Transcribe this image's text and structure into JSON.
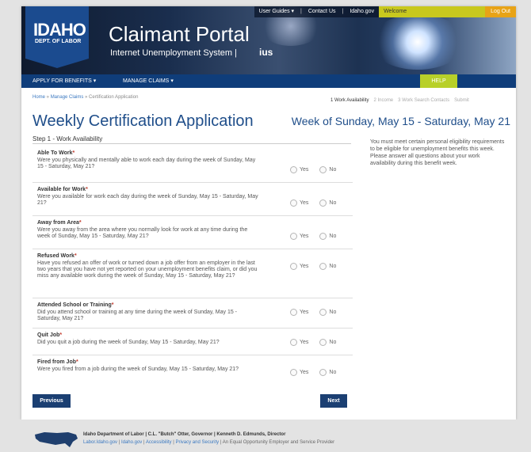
{
  "topbar": {
    "user_guides": "User Guides",
    "contact_us": "Contact Us",
    "idaho_gov": "Idaho.gov",
    "welcome": "Welcome",
    "logout": "Log Out"
  },
  "logo": {
    "line1": "IDAHO",
    "line2": "DEPT. OF LABOR"
  },
  "header": {
    "title": "Claimant Portal",
    "subtitle": "Internet Unemployment System |",
    "mark": "ius"
  },
  "nav": {
    "apply": "APPLY FOR BENEFITS",
    "manage": "MANAGE CLAIMS",
    "help": "HELP"
  },
  "breadcrumb": {
    "home": "Home",
    "manage": "Manage Claims",
    "current": "Certification Application"
  },
  "steps": [
    "1  Work Availability",
    "2  Income",
    "3  Work Search Contacts",
    "Submit"
  ],
  "page": {
    "title": "Weekly Certification Application",
    "week": "Week of Sunday, May 15 - Saturday, May 21",
    "step_title": "Step 1 - Work Availability"
  },
  "sidebar": {
    "text": "You must meet certain personal eligibility requirements to be eligible for unemployment benefits this week. Please answer all questions about your work availability during this benefit week."
  },
  "option_yes": "Yes",
  "option_no": "No",
  "questions": [
    {
      "title": "Able To Work",
      "body": "Were you physically and mentally able to work each day during the week of Sunday, May 15 - Saturday, May 21?"
    },
    {
      "title": "Available for Work",
      "body": "Were you available for work each day during the week of Sunday, May 15 - Saturday, May 21?"
    },
    {
      "title": "Away from Area",
      "body": "Were you away from the area where you normally look for work at any time during the week of Sunday, May 15 - Saturday, May 21?"
    },
    {
      "title": "Refused Work",
      "body": "Have you refused an offer of work or turned down a job offer from an employer in the last two years that you have not yet reported on your unemployment benefits claim, or did you miss any available work during the week of Sunday, May 15 - Saturday, May 21?"
    },
    {
      "title": "Attended School or Training",
      "body": "Did you attend school or training at any time during the week of Sunday, May 15 - Saturday, May 21?"
    },
    {
      "title": "Quit Job",
      "body": "Did you quit a job during the week of Sunday, May 15 - Saturday, May 21?"
    },
    {
      "title": "Fired from Job",
      "body": "Were you fired from a job during the week of Sunday, May 15 - Saturday, May 21?"
    }
  ],
  "buttons": {
    "previous": "Previous",
    "next": "Next"
  },
  "footer": {
    "line1": "Idaho Department of Labor  |  C.L. \"Butch\" Otter, Governor  |  Kenneth D. Edmunds, Director",
    "links": [
      "Labor.Idaho.gov",
      "Idaho.gov",
      "Accessibility",
      "Privacy and Security"
    ],
    "eeo": "An Equal Opportunity Employer and Service Provider"
  }
}
